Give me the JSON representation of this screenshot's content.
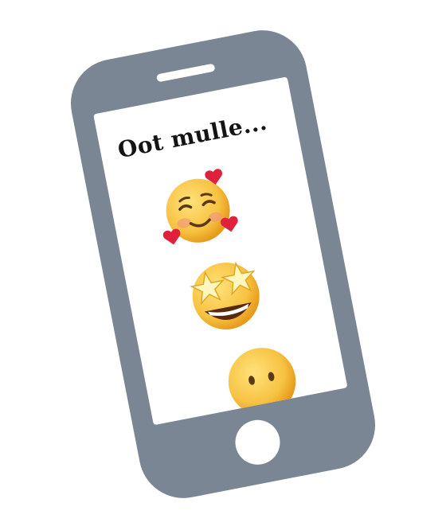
{
  "screen": {
    "title": "Oot mulle..."
  },
  "emojis": [
    {
      "name": "smiling-face-with-hearts-icon"
    },
    {
      "name": "star-struck-icon"
    },
    {
      "name": "face-without-mouth-icon"
    }
  ],
  "colors": {
    "phone_body": "#7a8694",
    "screen": "#ffffff",
    "text": "#141414",
    "emoji_face": "#f7c242",
    "heart": "#e0213b"
  }
}
